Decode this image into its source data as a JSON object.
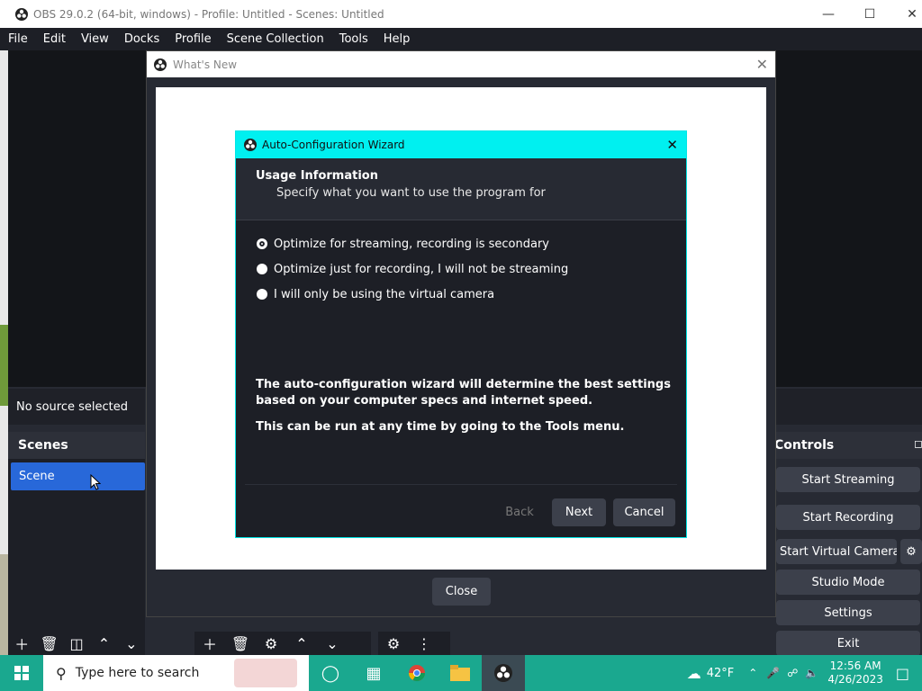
{
  "window": {
    "title": "OBS 29.0.2 (64-bit, windows) - Profile: Untitled - Scenes: Untitled",
    "minimize_icon": "minimize-icon",
    "maximize_icon": "maximize-icon",
    "close_icon": "close-icon"
  },
  "menu": [
    "File",
    "Edit",
    "View",
    "Docks",
    "Profile",
    "Scene Collection",
    "Tools",
    "Help"
  ],
  "sources": {
    "no_source": "No source selected"
  },
  "scenes": {
    "header": "Scenes",
    "items": [
      "Scene"
    ]
  },
  "controls": {
    "header": "Controls",
    "buttons": [
      "Start Streaming",
      "Start Recording",
      "Start Virtual Camera",
      "Studio Mode",
      "Settings",
      "Exit"
    ]
  },
  "whats_new": {
    "title": "What's New",
    "close_button": "Close"
  },
  "wizard": {
    "title": "Auto-Configuration Wizard",
    "header_title": "Usage Information",
    "header_subtitle": "Specify what you want to use the program for",
    "options": [
      {
        "label": "Optimize for streaming, recording is secondary",
        "checked": true
      },
      {
        "label": "Optimize just for recording, I will not be streaming",
        "checked": false
      },
      {
        "label": "I will only be using the virtual camera",
        "checked": false
      }
    ],
    "desc1": "The auto-configuration wizard will determine the best settings based on your computer specs and internet speed.",
    "desc2": "This can be run at any time by going to the Tools menu.",
    "buttons": {
      "back": "Back",
      "next": "Next",
      "cancel": "Cancel"
    }
  },
  "taskbar": {
    "search_placeholder": "Type here to search",
    "weather": "42°F",
    "time": "12:56 AM",
    "date": "4/26/2023"
  },
  "colors": {
    "accent": "#2868d9",
    "wizard_title": "#00f0f0",
    "taskbar": "#1aa88f"
  }
}
